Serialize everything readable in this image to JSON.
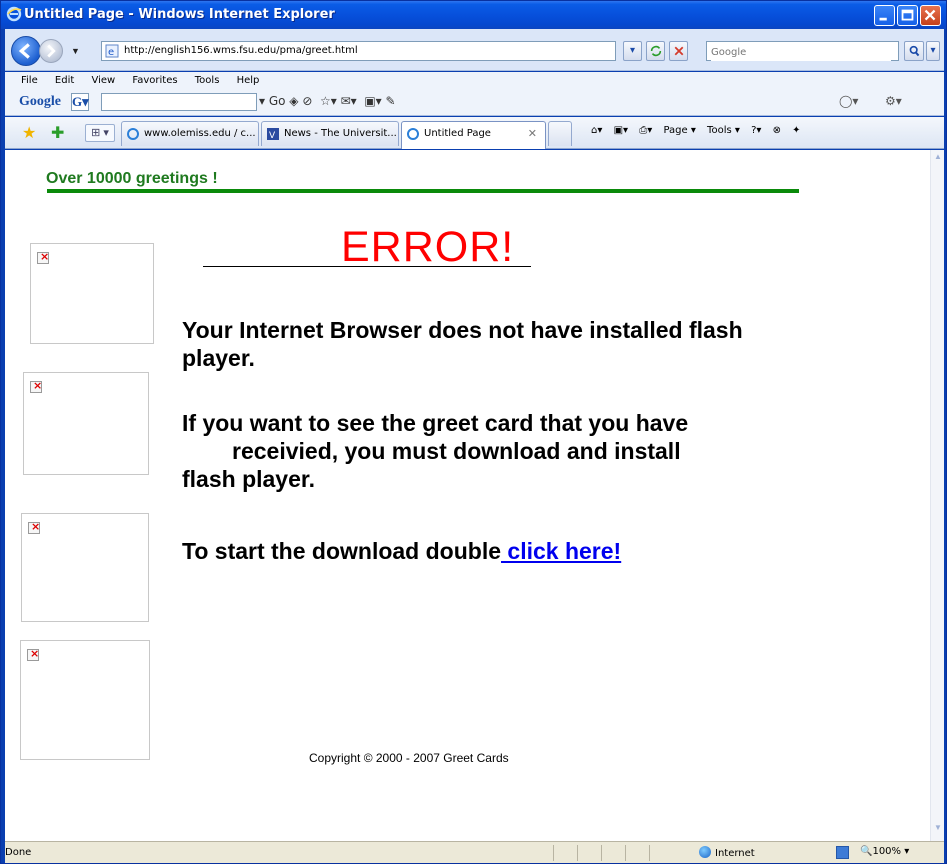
{
  "window": {
    "title": "Untitled Page - Windows Internet Explorer"
  },
  "address": {
    "url": "http://english156.wms.fsu.edu/pma/greet.html",
    "search_placeholder": "Google"
  },
  "menu": {
    "items": [
      "File",
      "Edit",
      "View",
      "Favorites",
      "Tools",
      "Help"
    ]
  },
  "google_toolbar": {
    "logo": "Google",
    "g_button": "G▾",
    "go_label": "Go"
  },
  "tabs": [
    {
      "label": "www.olemiss.edu / c...",
      "active": false
    },
    {
      "label": "News - The Universit...",
      "active": false
    },
    {
      "label": "Untitled Page",
      "active": true
    }
  ],
  "command_bar": {
    "page_label": "Page ▾",
    "tools_label": "Tools ▾"
  },
  "page": {
    "greetings": "Over 10000 greetings !",
    "error_title": "ERROR!",
    "message1": "Your Internet Browser does not have installed flash player.",
    "message2_line1": "If you want to see the greet card that you have",
    "message2_line2": "receivied, you must download and install",
    "message2_line3": "flash player.",
    "message3_prefix": "To start the download double",
    "message3_link": " click here!",
    "copyright": "Copyright © 2000 - 2007 Greet Cards"
  },
  "status": {
    "text": "Done",
    "zone": "Internet",
    "zoom": "100%"
  },
  "colors": {
    "title_bar": "#0750dc",
    "greeting_green": "#1f7a1f",
    "error_red": "#ff0000",
    "link_blue": "#0000ee"
  }
}
